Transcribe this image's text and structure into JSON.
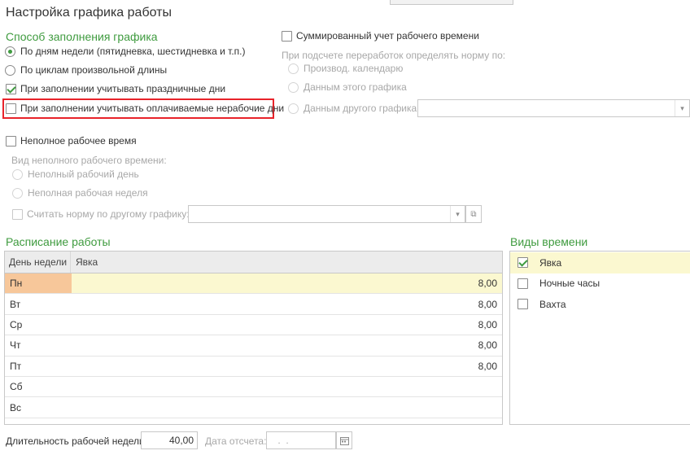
{
  "title": "Настройка графика работы",
  "fill_method": {
    "heading": "Способ заполнения графика",
    "by_weekdays": "По дням недели (пятидневка, шестидневка и т.п.)",
    "by_cycles": "По циклам произвольной длины",
    "consider_holidays": "При заполнении учитывать праздничные дни",
    "consider_paid_nonworking": "При заполнении учитывать оплачиваемые нерабочие дни"
  },
  "summed": {
    "label": "Суммированный учет рабочего времени",
    "norm_caption": "При подсчете переработок определять норму по:",
    "opt_calendar": "Производ. календарю",
    "opt_this_schedule": "Данным этого графика",
    "opt_other_schedule": "Данным другого графика",
    "other_schedule_value": ""
  },
  "part_time": {
    "label": "Неполное рабочее время",
    "kind_caption": "Вид неполного рабочего времени:",
    "opt_day": "Неполный рабочий день",
    "opt_week": "Неполная рабочая неделя",
    "norm_other": "Считать норму по другому графику:",
    "norm_other_value": ""
  },
  "schedule": {
    "heading": "Расписание работы",
    "col_day": "День недели",
    "col_attendance": "Явка",
    "rows": [
      {
        "day": "Пн",
        "value": "8,00"
      },
      {
        "day": "Вт",
        "value": "8,00"
      },
      {
        "day": "Ср",
        "value": "8,00"
      },
      {
        "day": "Чт",
        "value": "8,00"
      },
      {
        "day": "Пт",
        "value": "8,00"
      },
      {
        "day": "Сб",
        "value": ""
      },
      {
        "day": "Вс",
        "value": ""
      }
    ]
  },
  "time_types": {
    "heading": "Виды времени",
    "items": [
      {
        "label": "Явка",
        "checked": true
      },
      {
        "label": "Ночные часы",
        "checked": false
      },
      {
        "label": "Вахта",
        "checked": false
      }
    ]
  },
  "footer": {
    "week_length_label": "Длительность рабочей недели:",
    "week_length_value": "40,00",
    "ref_date_label": "Дата отсчета:",
    "ref_date_value": " .  ."
  },
  "icons": {
    "dropdown": "▾",
    "open": "⧉",
    "calendar": "calendar-icon"
  },
  "colors": {
    "accent_green": "#3f9b3f",
    "highlight_red": "#e8232a",
    "selected_row": "#fbf8d0",
    "selected_cell": "#f7c79a"
  }
}
